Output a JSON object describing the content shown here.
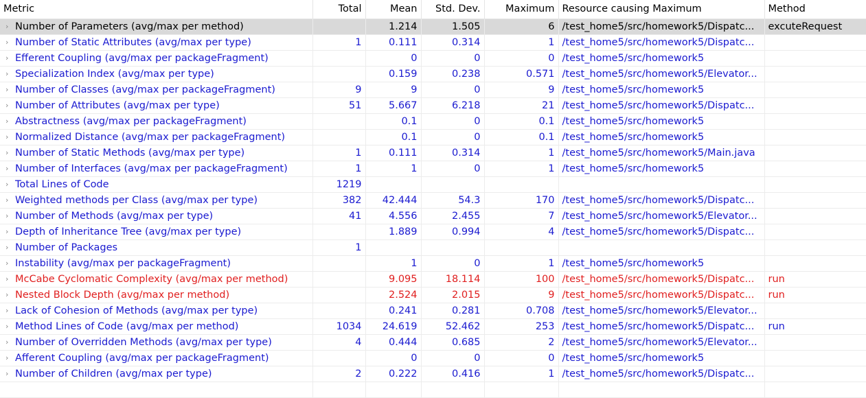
{
  "columns": {
    "metric": "Metric",
    "total": "Total",
    "mean": "Mean",
    "stddev": "Std. Dev.",
    "maximum": "Maximum",
    "resource": "Resource causing Maximum",
    "method": "Method"
  },
  "colors": {
    "normal_text": "#1a1ad0",
    "warning_text": "#e01e1e",
    "selected_bg": "#d9d9d9"
  },
  "rows": [
    {
      "metric": "Number of Parameters (avg/max per method)",
      "total": "",
      "mean": "1.214",
      "stddev": "1.505",
      "maximum": "6",
      "resource": "/test_home5/src/homework5/Dispatc...",
      "method": "excuteRequest",
      "state": "selected"
    },
    {
      "metric": "Number of Static Attributes (avg/max per type)",
      "total": "1",
      "mean": "0.111",
      "stddev": "0.314",
      "maximum": "1",
      "resource": "/test_home5/src/homework5/Dispatc...",
      "method": "",
      "state": "normal"
    },
    {
      "metric": "Efferent Coupling (avg/max per packageFragment)",
      "total": "",
      "mean": "0",
      "stddev": "0",
      "maximum": "0",
      "resource": "/test_home5/src/homework5",
      "method": "",
      "state": "normal"
    },
    {
      "metric": "Specialization Index (avg/max per type)",
      "total": "",
      "mean": "0.159",
      "stddev": "0.238",
      "maximum": "0.571",
      "resource": "/test_home5/src/homework5/Elevator...",
      "method": "",
      "state": "normal"
    },
    {
      "metric": "Number of Classes (avg/max per packageFragment)",
      "total": "9",
      "mean": "9",
      "stddev": "0",
      "maximum": "9",
      "resource": "/test_home5/src/homework5",
      "method": "",
      "state": "normal"
    },
    {
      "metric": "Number of Attributes (avg/max per type)",
      "total": "51",
      "mean": "5.667",
      "stddev": "6.218",
      "maximum": "21",
      "resource": "/test_home5/src/homework5/Dispatc...",
      "method": "",
      "state": "normal"
    },
    {
      "metric": "Abstractness (avg/max per packageFragment)",
      "total": "",
      "mean": "0.1",
      "stddev": "0",
      "maximum": "0.1",
      "resource": "/test_home5/src/homework5",
      "method": "",
      "state": "normal"
    },
    {
      "metric": "Normalized Distance (avg/max per packageFragment)",
      "total": "",
      "mean": "0.1",
      "stddev": "0",
      "maximum": "0.1",
      "resource": "/test_home5/src/homework5",
      "method": "",
      "state": "normal"
    },
    {
      "metric": "Number of Static Methods (avg/max per type)",
      "total": "1",
      "mean": "0.111",
      "stddev": "0.314",
      "maximum": "1",
      "resource": "/test_home5/src/homework5/Main.java",
      "method": "",
      "state": "normal"
    },
    {
      "metric": "Number of Interfaces (avg/max per packageFragment)",
      "total": "1",
      "mean": "1",
      "stddev": "0",
      "maximum": "1",
      "resource": "/test_home5/src/homework5",
      "method": "",
      "state": "normal"
    },
    {
      "metric": "Total Lines of Code",
      "total": "1219",
      "mean": "",
      "stddev": "",
      "maximum": "",
      "resource": "",
      "method": "",
      "state": "normal"
    },
    {
      "metric": "Weighted methods per Class (avg/max per type)",
      "total": "382",
      "mean": "42.444",
      "stddev": "54.3",
      "maximum": "170",
      "resource": "/test_home5/src/homework5/Dispatc...",
      "method": "",
      "state": "normal"
    },
    {
      "metric": "Number of Methods (avg/max per type)",
      "total": "41",
      "mean": "4.556",
      "stddev": "2.455",
      "maximum": "7",
      "resource": "/test_home5/src/homework5/Elevator...",
      "method": "",
      "state": "normal"
    },
    {
      "metric": "Depth of Inheritance Tree (avg/max per type)",
      "total": "",
      "mean": "1.889",
      "stddev": "0.994",
      "maximum": "4",
      "resource": "/test_home5/src/homework5/Dispatc...",
      "method": "",
      "state": "normal"
    },
    {
      "metric": "Number of Packages",
      "total": "1",
      "mean": "",
      "stddev": "",
      "maximum": "",
      "resource": "",
      "method": "",
      "state": "normal"
    },
    {
      "metric": "Instability (avg/max per packageFragment)",
      "total": "",
      "mean": "1",
      "stddev": "0",
      "maximum": "1",
      "resource": "/test_home5/src/homework5",
      "method": "",
      "state": "normal"
    },
    {
      "metric": "McCabe Cyclomatic Complexity (avg/max per method)",
      "total": "",
      "mean": "9.095",
      "stddev": "18.114",
      "maximum": "100",
      "resource": "/test_home5/src/homework5/Dispatc...",
      "method": "run",
      "state": "warning"
    },
    {
      "metric": "Nested Block Depth (avg/max per method)",
      "total": "",
      "mean": "2.524",
      "stddev": "2.015",
      "maximum": "9",
      "resource": "/test_home5/src/homework5/Dispatc...",
      "method": "run",
      "state": "warning"
    },
    {
      "metric": "Lack of Cohesion of Methods (avg/max per type)",
      "total": "",
      "mean": "0.241",
      "stddev": "0.281",
      "maximum": "0.708",
      "resource": "/test_home5/src/homework5/Elevator...",
      "method": "",
      "state": "normal"
    },
    {
      "metric": "Method Lines of Code (avg/max per method)",
      "total": "1034",
      "mean": "24.619",
      "stddev": "52.462",
      "maximum": "253",
      "resource": "/test_home5/src/homework5/Dispatc...",
      "method": "run",
      "state": "normal"
    },
    {
      "metric": "Number of Overridden Methods (avg/max per type)",
      "total": "4",
      "mean": "0.444",
      "stddev": "0.685",
      "maximum": "2",
      "resource": "/test_home5/src/homework5/Elevator...",
      "method": "",
      "state": "normal"
    },
    {
      "metric": "Afferent Coupling (avg/max per packageFragment)",
      "total": "",
      "mean": "0",
      "stddev": "0",
      "maximum": "0",
      "resource": "/test_home5/src/homework5",
      "method": "",
      "state": "normal"
    },
    {
      "metric": "Number of Children (avg/max per type)",
      "total": "2",
      "mean": "0.222",
      "stddev": "0.416",
      "maximum": "1",
      "resource": "/test_home5/src/homework5/Dispatc...",
      "method": "",
      "state": "normal"
    }
  ],
  "icons": {
    "expand": "chevron-right-icon",
    "expand_glyph": "›"
  }
}
